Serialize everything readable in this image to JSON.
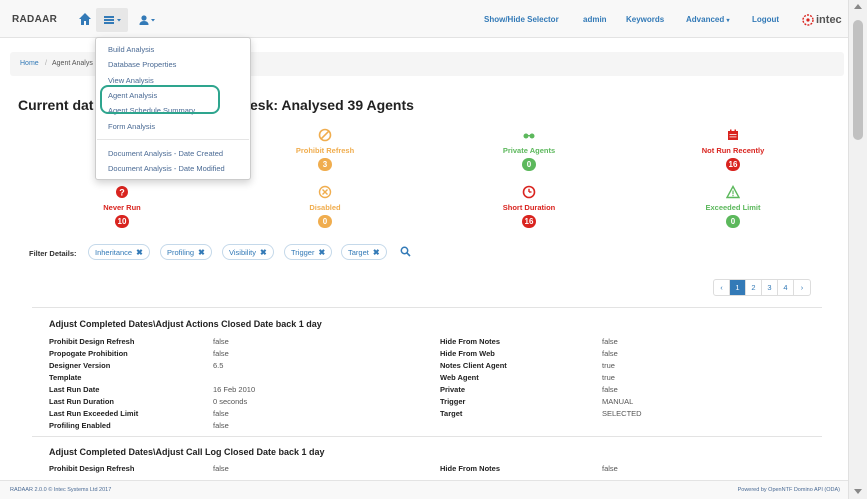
{
  "navbar": {
    "brand": "RADAAR",
    "show_hide_selector": "Show/Hide Selector",
    "admin": "admin",
    "keywords": "Keywords",
    "advanced": "Advanced",
    "logout": "Logout",
    "logo_text": "intec"
  },
  "dropdown": {
    "items": [
      "Build Analysis",
      "Database Properties",
      "View Analysis",
      "Agent Analysis",
      "Agent Schedule Summary",
      "Form Analysis",
      "Document Analysis - Date Created",
      "Document Analysis - Date Modified"
    ]
  },
  "breadcrumb": {
    "home": "Home",
    "separator": "/",
    "current": "Agent Analys"
  },
  "page": {
    "title_left": "Current dat",
    "title_right": "esk: Analysed 39 Agents"
  },
  "statuses": [
    {
      "label": "Prohibit Refresh",
      "count": "3",
      "color": "#f0ad4e"
    },
    {
      "label": "Private Agents",
      "count": "0",
      "color": "#5cb85c"
    },
    {
      "label": "Not Run Recently",
      "count": "16",
      "color": "#d9241f"
    },
    {
      "label": "Never Run",
      "count": "10",
      "color": "#d9241f"
    },
    {
      "label": "Disabled",
      "count": "0",
      "color": "#f0ad4e"
    },
    {
      "label": "Short Duration",
      "count": "16",
      "color": "#d9241f"
    },
    {
      "label": "Exceeded Limit",
      "count": "0",
      "color": "#5cb85c"
    }
  ],
  "filter": {
    "label": "Filter Details:",
    "chips": [
      "Inheritance",
      "Profiling",
      "Visibility",
      "Trigger",
      "Target"
    ]
  },
  "pagination": {
    "prev": "‹",
    "pages": [
      "1",
      "2",
      "3",
      "4"
    ],
    "next": "›"
  },
  "records": [
    {
      "title": "Adjust Completed Dates\\Adjust Actions Closed Date back 1 day",
      "left_fields": [
        {
          "label": "Prohibit Design Refresh",
          "value": "false"
        },
        {
          "label": "Propogate Prohibition",
          "value": "false"
        },
        {
          "label": "Designer Version",
          "value": "6.5"
        },
        {
          "label": "Template",
          "value": ""
        },
        {
          "label": "Last Run Date",
          "value": "16 Feb 2010"
        },
        {
          "label": "Last Run Duration",
          "value": "0 seconds"
        },
        {
          "label": "Last Run Exceeded Limit",
          "value": "false"
        },
        {
          "label": "Profiling Enabled",
          "value": "false"
        }
      ],
      "right_fields": [
        {
          "label": "Hide From Notes",
          "value": "false"
        },
        {
          "label": "Hide From Web",
          "value": "false"
        },
        {
          "label": "Notes Client Agent",
          "value": "true"
        },
        {
          "label": "Web Agent",
          "value": "true"
        },
        {
          "label": "Private",
          "value": "false"
        },
        {
          "label": "Trigger",
          "value": "MANUAL"
        },
        {
          "label": "Target",
          "value": "SELECTED"
        }
      ]
    },
    {
      "title": "Adjust Completed Dates\\Adjust Call Log Closed Date back 1 day",
      "left_fields": [
        {
          "label": "Prohibit Design Refresh",
          "value": "false"
        }
      ],
      "right_fields": [
        {
          "label": "Hide From Notes",
          "value": "false"
        }
      ]
    }
  ],
  "footer": {
    "left": "RADAAR 2.0.0 © Intec Systems Ltd 2017",
    "right": "Powered by OpenNTF Domino API (ODA)"
  }
}
